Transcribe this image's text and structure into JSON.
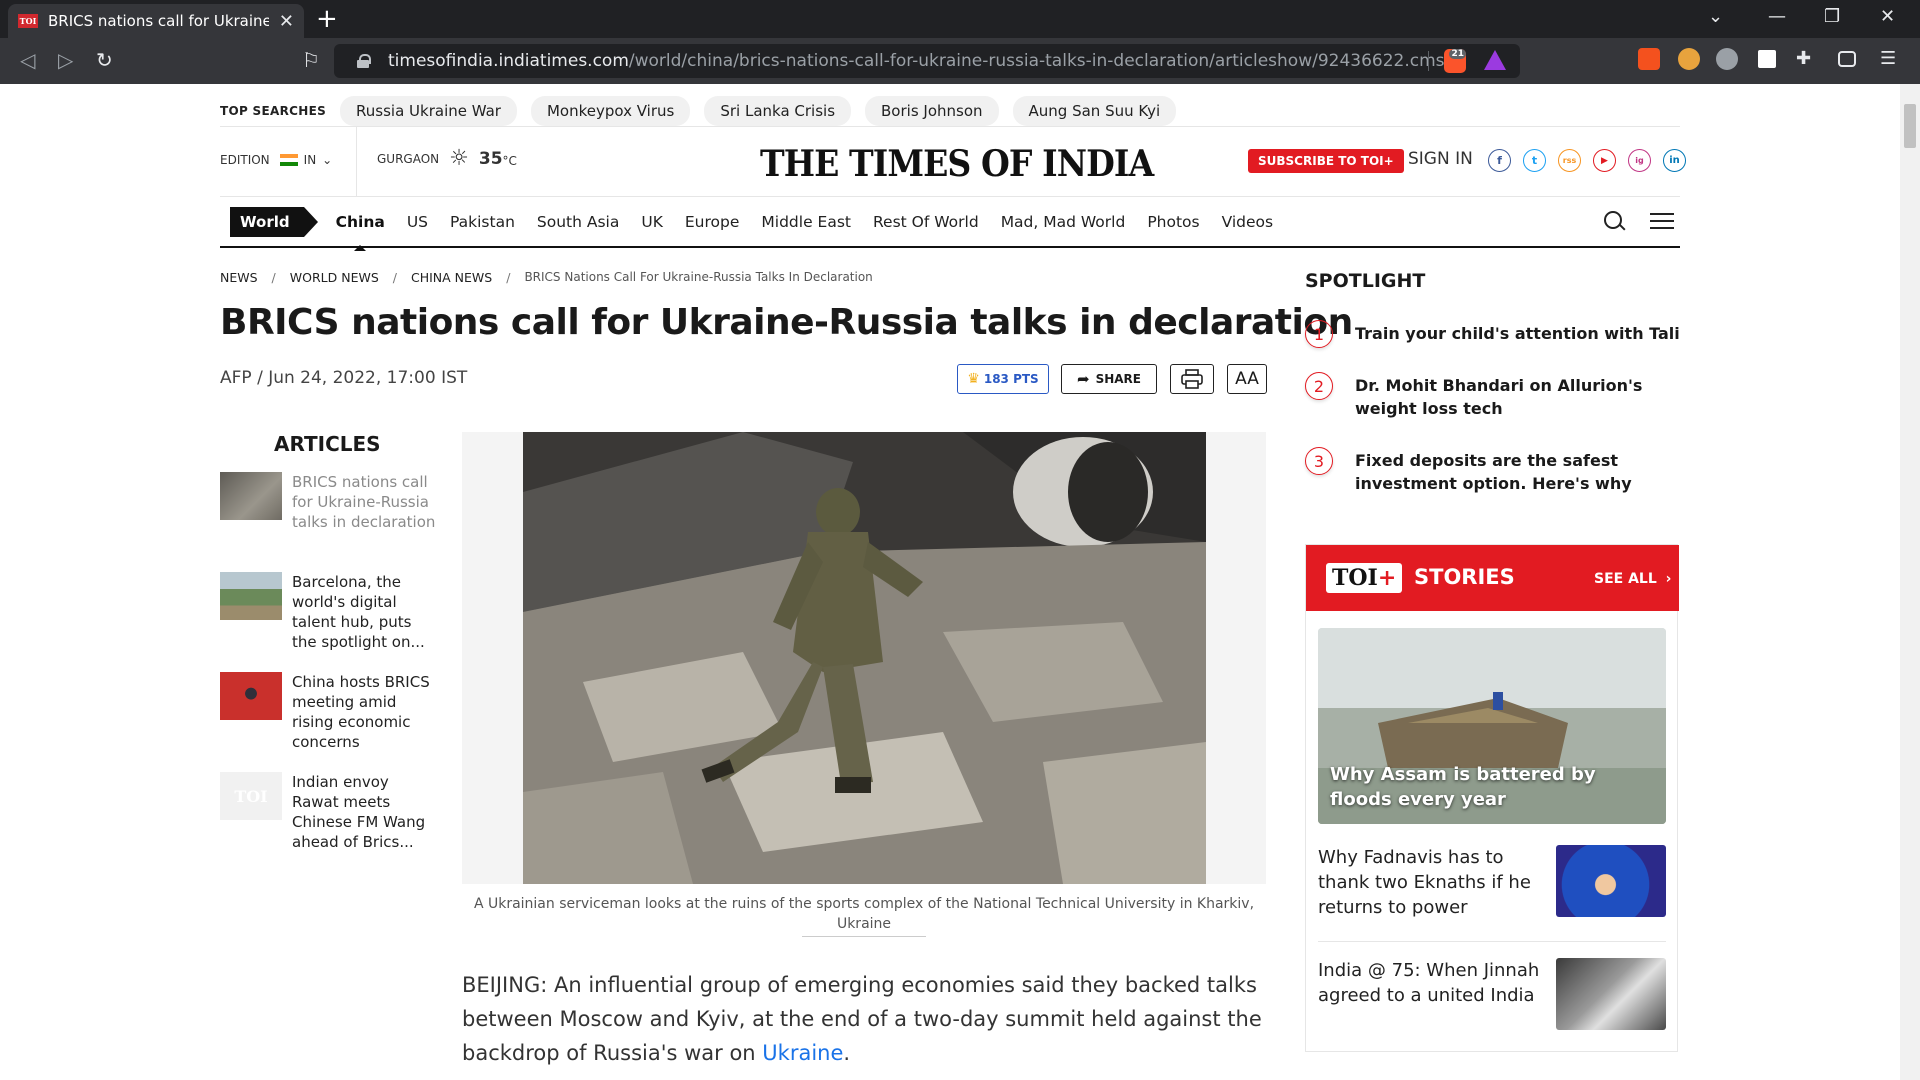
{
  "browser": {
    "tab_title": "BRICS nations call for Ukraine-Russia talks in declaration",
    "favicon_text": "TOI",
    "url_host": "timesofindia.indiatimes.com",
    "url_path": "/world/china/brics-nations-call-for-ukraine-russia-talks-in-declaration/articleshow/92436622.cms",
    "brave_badge": "21"
  },
  "top_searches": {
    "label": "TOP SEARCHES",
    "items": [
      "Russia Ukraine War",
      "Monkeypox Virus",
      "Sri Lanka Crisis",
      "Boris Johnson",
      "Aung San Suu Kyi"
    ]
  },
  "header": {
    "edition_label": "EDITION",
    "edition_value": "IN",
    "city": "GURGAON",
    "temperature": "35",
    "temp_unit": "°C",
    "logo": "THE TIMES OF INDIA",
    "subscribe": "SUBSCRIBE TO TOI+",
    "signin": "SIGN IN",
    "social": [
      "f",
      "t",
      "rss",
      "▶",
      "ig",
      "in"
    ]
  },
  "nav": {
    "section": "World",
    "items": [
      "China",
      "US",
      "Pakistan",
      "South Asia",
      "UK",
      "Europe",
      "Middle East",
      "Rest Of World",
      "Mad, Mad World",
      "Photos",
      "Videos"
    ],
    "active": "China"
  },
  "breadcrumb": [
    "NEWS",
    "WORLD NEWS",
    "CHINA NEWS",
    "BRICS Nations Call For Ukraine-Russia Talks In Declaration"
  ],
  "article": {
    "headline": "BRICS nations call for Ukraine-Russia talks in declaration",
    "byline": "AFP / Jun 24, 2022, 17:00 IST",
    "points": "183 PTS",
    "share": "SHARE",
    "fontsize_label": "AA",
    "caption": "A Ukrainian serviceman looks at the ruins of the sports complex of the National Technical University in Kharkiv, Ukraine",
    "body_before_link": "BEIJING: An influential group of emerging economies said they backed talks between Moscow and Kyiv, at the end of a two-day summit held against the backdrop of Russia's war on ",
    "body_link": "Ukraine",
    "body_after_link": "."
  },
  "articles_sidebar": {
    "title": "ARTICLES",
    "items": [
      "BRICS nations call for Ukraine-Russia talks in declaration",
      "Barcelona, the world's digital talent hub, puts the spotlight on...",
      "China hosts BRICS meeting amid rising economic concerns",
      "Indian envoy Rawat meets Chinese FM Wang ahead of Brics..."
    ],
    "placeholder_logo": "TOI"
  },
  "spotlight": {
    "title": "SPOTLIGHT",
    "items": [
      {
        "num": "1",
        "text": "Train your child's attention with Tali"
      },
      {
        "num": "2",
        "text": "Dr. Mohit Bhandari on Allurion's weight loss tech"
      },
      {
        "num": "3",
        "text": "Fixed deposits are the safest investment option. Here's why"
      }
    ]
  },
  "stories": {
    "badge": "TOI",
    "badge_plus": "+",
    "title": "STORIES",
    "see_all": "SEE ALL",
    "hero": "Why Assam is battered by floods every year",
    "items": [
      "Why Fadnavis has to thank two Eknaths if he returns to power",
      "India @ 75: When Jinnah agreed to a united India"
    ]
  },
  "colors": {
    "brand_red": "#e21b22",
    "link_blue": "#1a73e8",
    "pts_blue": "#2a59c4"
  }
}
